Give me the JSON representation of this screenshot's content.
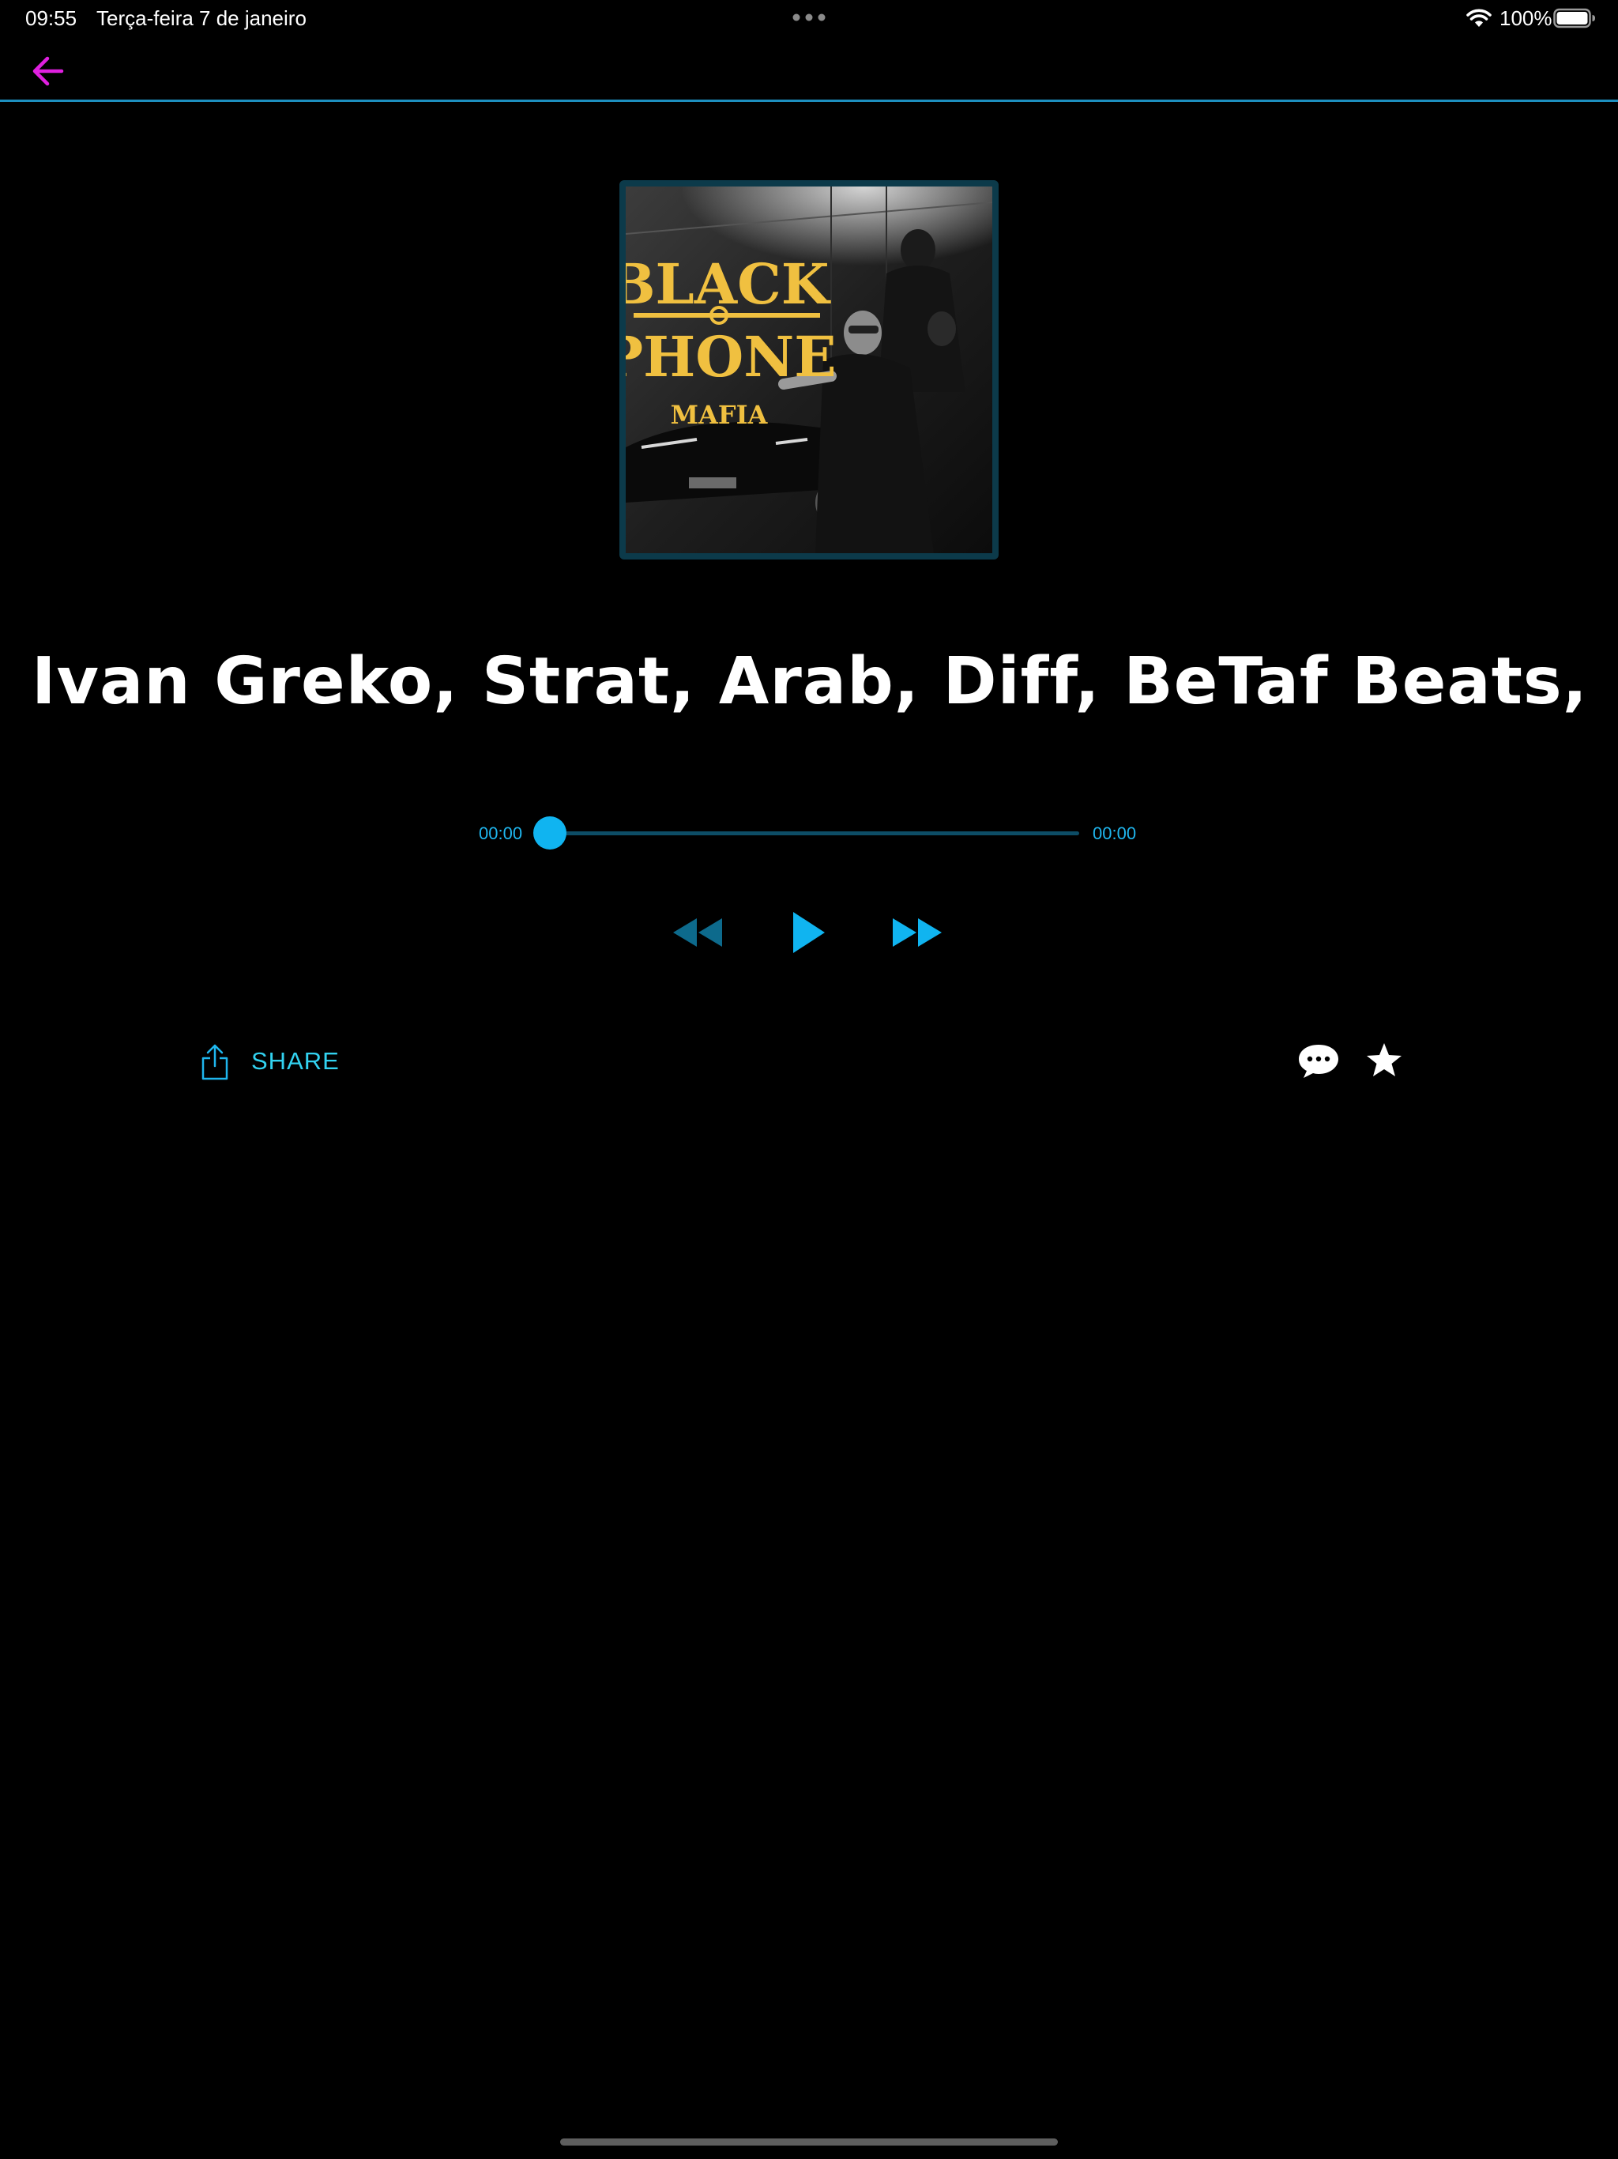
{
  "status_bar": {
    "time": "09:55",
    "date": "Terça-feira 7 de janeiro",
    "battery_percent": "100%",
    "icons": [
      "multitask-dots-icon",
      "wifi-icon",
      "battery-icon"
    ]
  },
  "nav": {
    "back_icon": "arrow-left-icon",
    "accent_color": "#e020e0",
    "divider_color": "#1d8fbf"
  },
  "album": {
    "art_text_line1": "BLACK",
    "art_text_line2": "PHONE",
    "art_text_line3": "MAFIA"
  },
  "track": {
    "title": "Ivan Greko, Strat, Arab, Diff, BeTaf Beats, S..."
  },
  "player": {
    "elapsed": "00:00",
    "total": "00:00",
    "progress": 0,
    "accent_color": "#1fb6ee",
    "controls": [
      "rewind-icon",
      "play-icon",
      "fast-forward-icon"
    ]
  },
  "actions": {
    "share_label": "SHARE",
    "share_icon": "share-icon",
    "comment_icon": "comment-icon",
    "favorite_icon": "star-icon"
  }
}
